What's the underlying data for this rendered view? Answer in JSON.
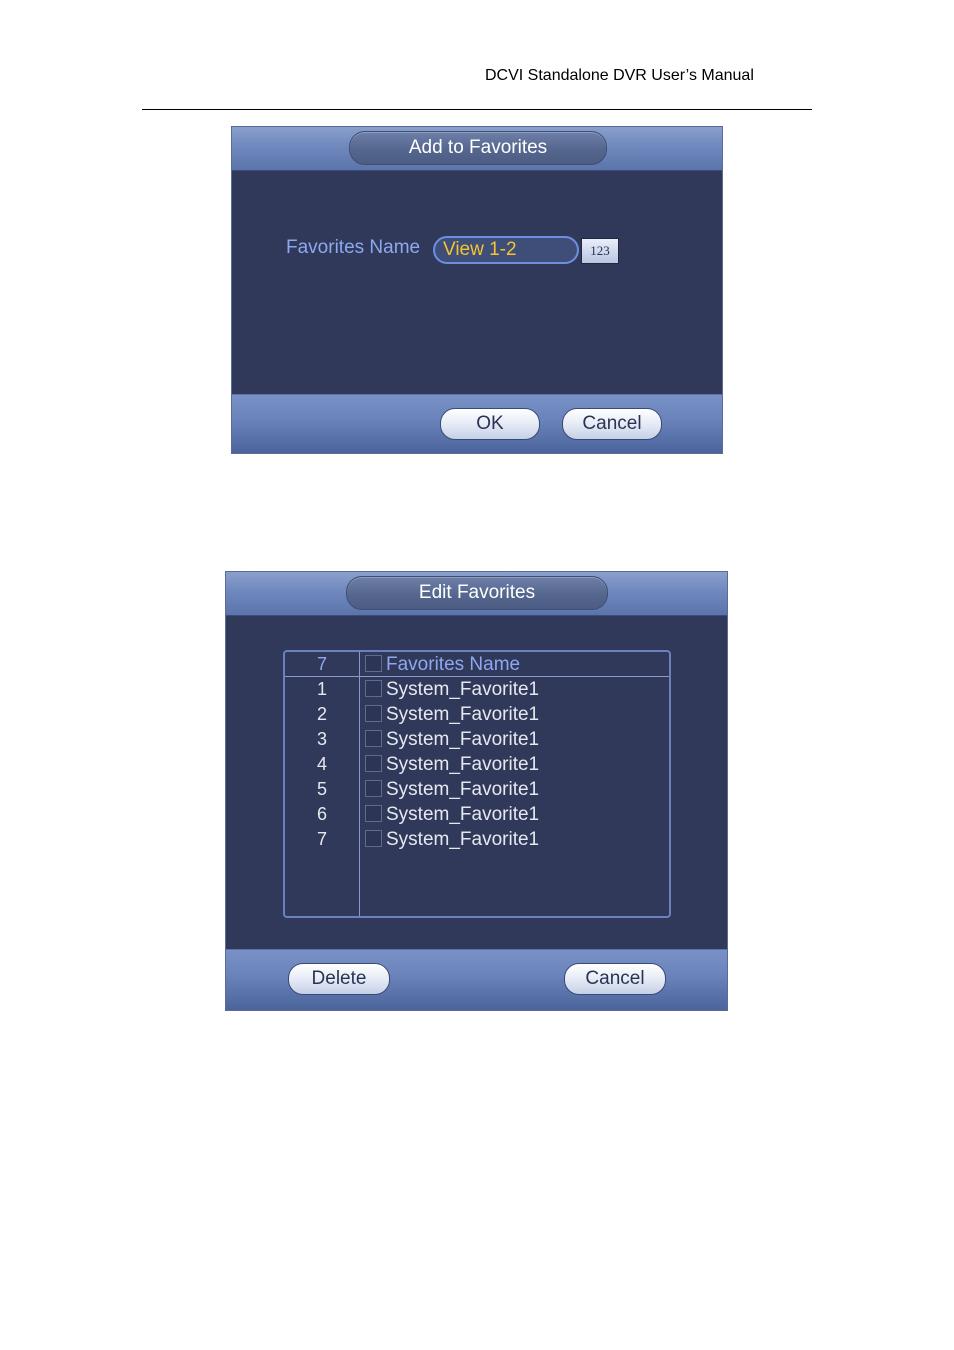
{
  "document": {
    "header_text": "DCVI Standalone DVR User’s Manual"
  },
  "add_dialog": {
    "title": "Add to Favorites",
    "favorites_name_label": "Favorites Name",
    "favorites_name_value": "View 1-2",
    "keyboard_button_label": "123",
    "ok_label": "OK",
    "cancel_label": "Cancel"
  },
  "edit_dialog": {
    "title": "Edit Favorites",
    "table": {
      "header": {
        "count": "7",
        "name": "Favorites Name",
        "checked": false
      },
      "rows": [
        {
          "index": "1",
          "name": "System_Favorite1",
          "checked": false
        },
        {
          "index": "2",
          "name": "System_Favorite1",
          "checked": false
        },
        {
          "index": "3",
          "name": "System_Favorite1",
          "checked": false
        },
        {
          "index": "4",
          "name": "System_Favorite1",
          "checked": false
        },
        {
          "index": "5",
          "name": "System_Favorite1",
          "checked": false
        },
        {
          "index": "6",
          "name": "System_Favorite1",
          "checked": false
        },
        {
          "index": "7",
          "name": "System_Favorite1",
          "checked": false
        }
      ]
    },
    "delete_label": "Delete",
    "cancel_label": "Cancel"
  },
  "colors": {
    "dialog_body": "#30395a",
    "label_blue": "#8ea8f0",
    "input_text_yellow": "#f2c531",
    "row_text": "#e6e8f0"
  }
}
